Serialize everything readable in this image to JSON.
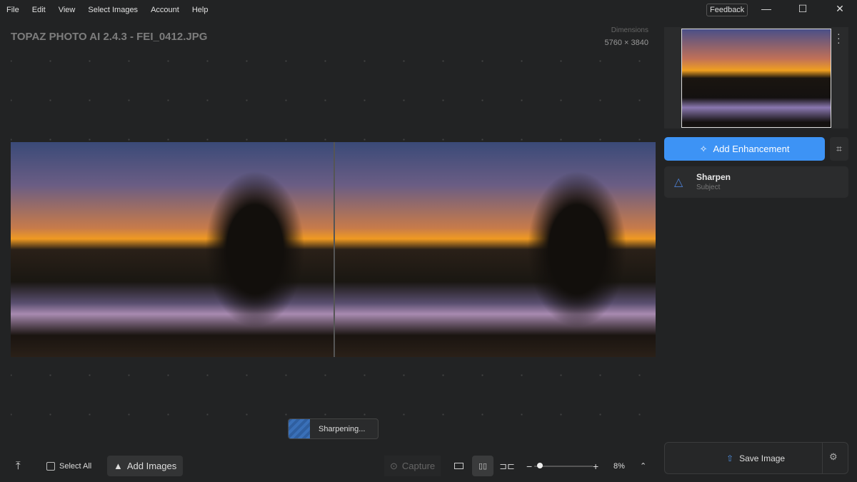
{
  "menu": [
    "File",
    "Edit",
    "View",
    "Select Images",
    "Account",
    "Help"
  ],
  "feedback": "Feedback",
  "window": {
    "minimize": "—",
    "maximize": "☐",
    "close": "✕"
  },
  "title": "TOPAZ PHOTO AI 2.4.3 - FEI_0412.JPG",
  "dimensions": {
    "label": "Dimensions",
    "value": "5760 × 3840"
  },
  "status": "Sharpening...",
  "bottom": {
    "select_all": "Select All",
    "add_images": "Add Images",
    "capture": "Capture",
    "zoom": "8%",
    "zoom_fraction": 0.08
  },
  "panel": {
    "add_enhancement": "Add Enhancement",
    "enhancement": {
      "name": "Sharpen",
      "mode": "Subject"
    },
    "save": "Save Image"
  },
  "colors": {
    "accent": "#3d93f5",
    "bg": "#222324"
  }
}
